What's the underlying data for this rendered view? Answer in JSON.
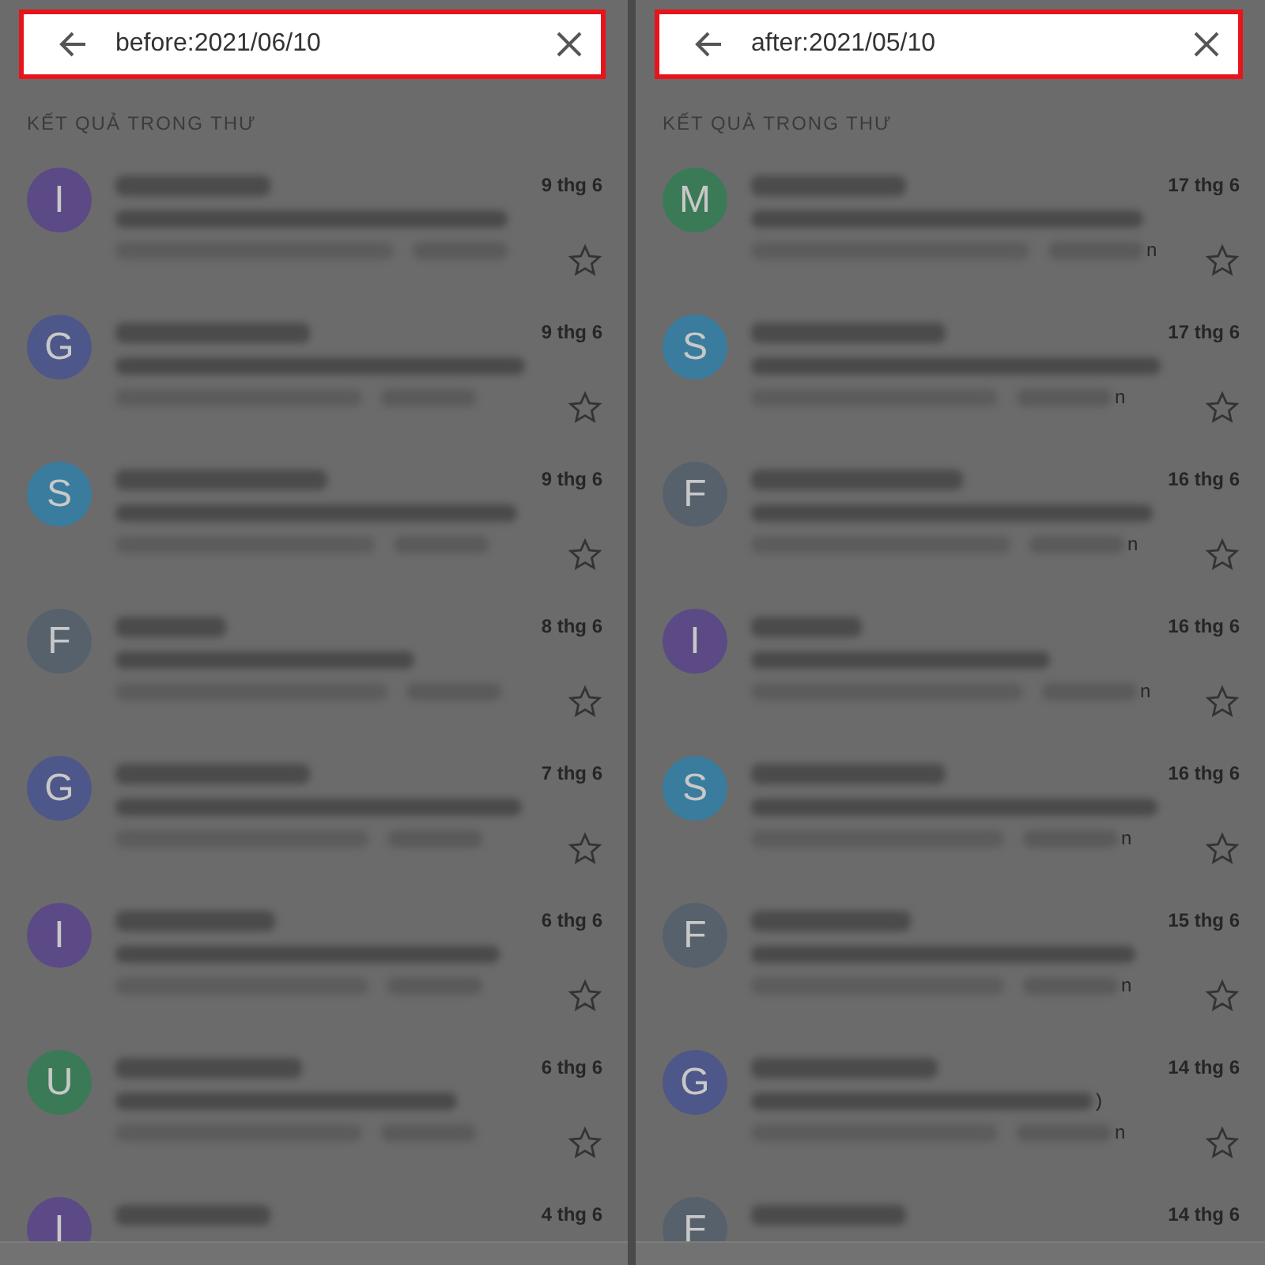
{
  "panels": [
    {
      "search": {
        "value": "before:2021/06/10",
        "highlighted": true
      },
      "section_title": "KẾT QUẢ TRONG THƯ",
      "messages": [
        {
          "initial": "I",
          "color": "#5b4a85",
          "date": "9 thg 6",
          "starred": false
        },
        {
          "initial": "G",
          "color": "#4d5789",
          "date": "9 thg 6",
          "starred": false
        },
        {
          "initial": "S",
          "color": "#3a7c9e",
          "date": "9 thg 6",
          "starred": false
        },
        {
          "initial": "F",
          "color": "#56616c",
          "date": "8 thg 6",
          "starred": false
        },
        {
          "initial": "G",
          "color": "#4d5789",
          "date": "7 thg 6",
          "starred": false
        },
        {
          "initial": "I",
          "color": "#5b4a85",
          "date": "6 thg 6",
          "starred": false
        },
        {
          "initial": "U",
          "color": "#3b7a57",
          "date": "6 thg 6",
          "starred": false
        },
        {
          "initial": "I",
          "color": "#5b4a85",
          "date": "4 thg 6"
        }
      ]
    },
    {
      "search": {
        "value": "after:2021/05/10",
        "highlighted": true
      },
      "section_title": "KẾT QUẢ TRONG THƯ",
      "messages": [
        {
          "initial": "M",
          "color": "#3b7a57",
          "date": "17 thg 6",
          "starred": false,
          "snippet_tail": "n"
        },
        {
          "initial": "S",
          "color": "#3a7c9e",
          "date": "17 thg 6",
          "starred": false,
          "snippet_tail": "n"
        },
        {
          "initial": "F",
          "color": "#56616c",
          "date": "16 thg 6",
          "starred": false,
          "snippet_tail": "n"
        },
        {
          "initial": "I",
          "color": "#5b4a85",
          "date": "16 thg 6",
          "starred": false,
          "snippet_tail": "n"
        },
        {
          "initial": "S",
          "color": "#3a7c9e",
          "date": "16 thg 6",
          "starred": false,
          "snippet_tail": "n"
        },
        {
          "initial": "F",
          "color": "#56616c",
          "date": "15 thg 6",
          "starred": false,
          "snippet_tail": "n"
        },
        {
          "initial": "G",
          "color": "#4d5789",
          "date": "14 thg 6",
          "starred": false,
          "preview_tail": ")",
          "snippet_tail": "n"
        },
        {
          "initial": "F",
          "color": "#56616c",
          "date": "14 thg 6"
        }
      ]
    }
  ]
}
